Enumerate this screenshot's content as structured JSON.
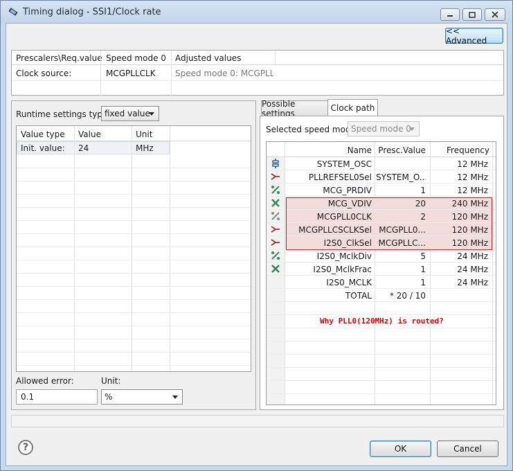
{
  "window": {
    "title": "Timing dialog - SSI1/Clock rate"
  },
  "advanced_button": "<< Advanced",
  "top_table": {
    "headers": [
      "Prescalers\\Req.value",
      "Speed mode 0",
      "Adjusted values"
    ],
    "row": [
      "Clock source:",
      "MCGPLLCLK",
      "Speed mode 0: MCGPLL..."
    ]
  },
  "runtime": {
    "label": "Runtime settings type:",
    "selected": "fixed value",
    "headers": [
      "Value type",
      "Value",
      "Unit"
    ],
    "row": [
      "Init. value:",
      "24",
      "MHz"
    ]
  },
  "allowed_error": {
    "label": "Allowed error:",
    "value": "0.1",
    "unit_label": "Unit:",
    "unit_selected": "%"
  },
  "tabs": [
    "Possible settings",
    "Clock path"
  ],
  "clock_path": {
    "speed_mode_label": "Selected speed mode",
    "speed_mode_selected": "Speed mode 0",
    "headers": [
      "Name",
      "Presc.Value",
      "Frequency"
    ],
    "rows": [
      {
        "icon": "oscillator-icon",
        "name": "SYSTEM_OSC",
        "presc": "",
        "freq": "12 MHz",
        "hl": false
      },
      {
        "icon": "mux-icon",
        "name": "PLLREFSEL0Sel",
        "presc": "SYSTEM_O...",
        "freq": "12 MHz",
        "hl": false
      },
      {
        "icon": "divider-icon",
        "name": "MCG_PRDIV",
        "presc": "1",
        "freq": "12 MHz",
        "hl": false
      },
      {
        "icon": "multiplier-icon",
        "name": "MCG_VDIV",
        "presc": "20",
        "freq": "240 MHz",
        "hl": true
      },
      {
        "icon": "divider-gray-icon",
        "name": "MCGPLL0CLK",
        "presc": "2",
        "freq": "120 MHz",
        "hl": true
      },
      {
        "icon": "mux-icon",
        "name": "MCGPLLCSCLKSel",
        "presc": "MCGPLL0...",
        "freq": "120 MHz",
        "hl": true
      },
      {
        "icon": "mux-icon",
        "name": "I2S0_ClkSel",
        "presc": "MCGPLLC...",
        "freq": "120 MHz",
        "hl": true
      },
      {
        "icon": "divider-icon",
        "name": "I2S0_MclkDiv",
        "presc": "5",
        "freq": "24 MHz",
        "hl": false
      },
      {
        "icon": "multiplier-icon",
        "name": "I2S0_MclkFrac",
        "presc": "1",
        "freq": "24 MHz",
        "hl": false
      },
      {
        "icon": "",
        "name": "I2S0_MCLK",
        "presc": "1",
        "freq": "24 MHz",
        "hl": false
      },
      {
        "icon": "",
        "name": "TOTAL",
        "presc": "* 20 / 10",
        "freq": "",
        "hl": false
      }
    ],
    "annotation": "Why PLL0(120MHz) is routed?"
  },
  "buttons": {
    "ok": "OK",
    "cancel": "Cancel",
    "help": "?"
  },
  "colors": {
    "highlight_border": "#d22020",
    "highlight_fill": "#f3dcdc",
    "annotation": "#e00000",
    "icon_green": "#2e8b57",
    "icon_red": "#a0302a",
    "icon_blue": "#2a5a9a"
  }
}
